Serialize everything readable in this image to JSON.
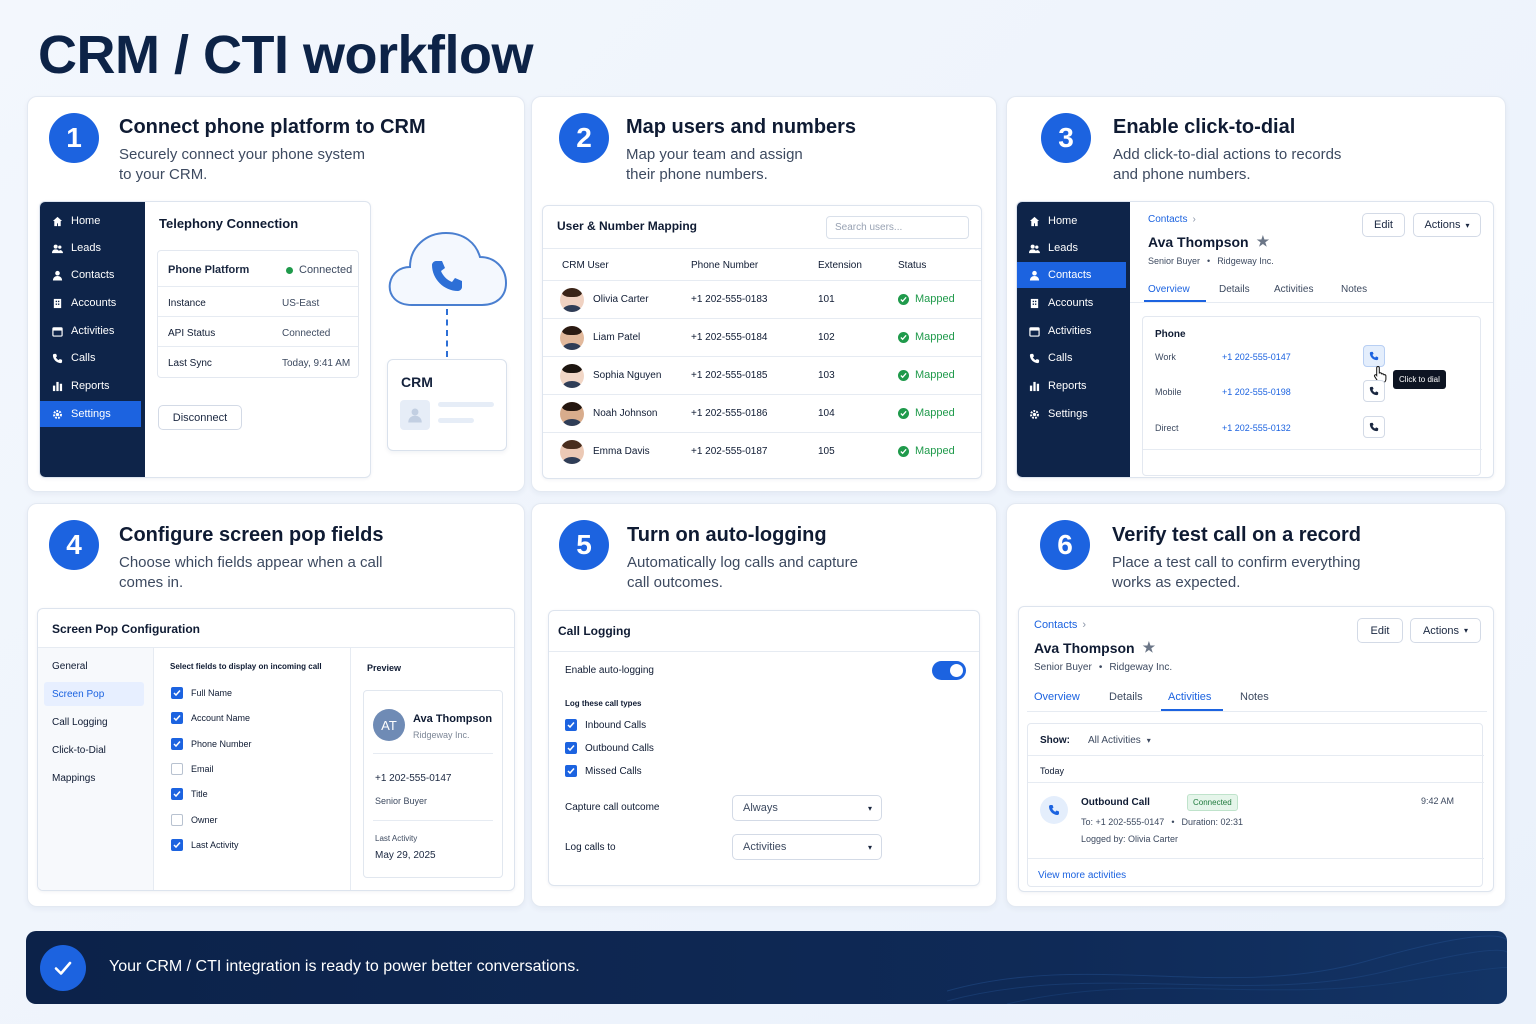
{
  "page_title": "CRM / CTI workflow",
  "colors": {
    "accent": "#1c63e0",
    "navy": "#0e2449",
    "success": "#1f9a4b"
  },
  "steps": [
    {
      "number": "1",
      "title": "Connect phone platform to CRM",
      "desc_line1": "Securely connect your phone system",
      "desc_line2": "to your CRM."
    },
    {
      "number": "2",
      "title": "Map users and numbers",
      "desc_line1": "Map your team and assign",
      "desc_line2": "their phone numbers."
    },
    {
      "number": "3",
      "title": "Enable click-to-dial",
      "desc_line1": "Add click-to-dial actions to records",
      "desc_line2": "and phone numbers."
    },
    {
      "number": "4",
      "title": "Configure screen pop fields",
      "desc_line1": "Choose which fields appear when a call",
      "desc_line2": "comes in."
    },
    {
      "number": "5",
      "title": "Turn on auto-logging",
      "desc_line1": "Automatically log calls and capture",
      "desc_line2": "call outcomes."
    },
    {
      "number": "6",
      "title": "Verify test call on a record",
      "desc_line1": "Place a test call to confirm everything",
      "desc_line2": "works as expected."
    }
  ],
  "nav": [
    "Home",
    "Leads",
    "Contacts",
    "Accounts",
    "Activities",
    "Calls",
    "Reports",
    "Settings"
  ],
  "telephony": {
    "title": "Telephony Connection",
    "platform_label": "Phone Platform",
    "platform_status": "Connected",
    "rows": [
      {
        "label": "Instance",
        "value": "US-East"
      },
      {
        "label": "API Status",
        "value": "Connected"
      },
      {
        "label": "Last Sync",
        "value": "Today, 9:41 AM"
      }
    ],
    "disconnect": "Disconnect",
    "crm_label": "CRM"
  },
  "mapping": {
    "title": "User & Number Mapping",
    "search_placeholder": "Search users...",
    "headers": [
      "CRM User",
      "Phone Number",
      "Extension",
      "Status"
    ],
    "rows": [
      {
        "user": "Olivia Carter",
        "phone": "+1 202-555-0183",
        "ext": "101",
        "status": "Mapped"
      },
      {
        "user": "Liam Patel",
        "phone": "+1 202-555-0184",
        "ext": "102",
        "status": "Mapped"
      },
      {
        "user": "Sophia Nguyen",
        "phone": "+1 202-555-0185",
        "ext": "103",
        "status": "Mapped"
      },
      {
        "user": "Noah Johnson",
        "phone": "+1 202-555-0186",
        "ext": "104",
        "status": "Mapped"
      },
      {
        "user": "Emma Davis",
        "phone": "+1 202-555-0187",
        "ext": "105",
        "status": "Mapped"
      }
    ]
  },
  "contact": {
    "breadcrumb": "Contacts",
    "name": "Ava Thompson",
    "role": "Senior Buyer",
    "company": "Ridgeway Inc.",
    "edit": "Edit",
    "actions": "Actions",
    "tabs": [
      "Overview",
      "Details",
      "Activities",
      "Notes"
    ],
    "phone_title": "Phone",
    "phones": [
      {
        "label": "Work",
        "number": "+1 202-555-0147"
      },
      {
        "label": "Mobile",
        "number": "+1 202-555-0198"
      },
      {
        "label": "Direct",
        "number": "+1 202-555-0132"
      }
    ],
    "tooltip": "Click to dial"
  },
  "screenpop": {
    "title": "Screen Pop Configuration",
    "menu": [
      "General",
      "Screen Pop",
      "Call Logging",
      "Click-to-Dial",
      "Mappings"
    ],
    "fields_title": "Select fields to display on incoming call",
    "fields": [
      {
        "label": "Full Name",
        "checked": true
      },
      {
        "label": "Account Name",
        "checked": true
      },
      {
        "label": "Phone Number",
        "checked": true
      },
      {
        "label": "Email",
        "checked": false
      },
      {
        "label": "Title",
        "checked": true
      },
      {
        "label": "Owner",
        "checked": false
      },
      {
        "label": "Last Activity",
        "checked": true
      }
    ],
    "preview_title": "Preview",
    "preview": {
      "initials": "AT",
      "name": "Ava Thompson",
      "company": "Ridgeway Inc.",
      "phone": "+1 202-555-0147",
      "role": "Senior Buyer",
      "last_activity_label": "Last Activity",
      "last_activity": "May 29, 2025"
    }
  },
  "logging": {
    "title": "Call Logging",
    "enable_label": "Enable auto-logging",
    "enabled": true,
    "types_title": "Log these call types",
    "types": [
      "Inbound Calls",
      "Outbound Calls",
      "Missed Calls"
    ],
    "outcome_label": "Capture call outcome",
    "outcome_value": "Always",
    "logto_label": "Log calls to",
    "logto_value": "Activities"
  },
  "verify": {
    "show_label": "Show:",
    "show_value": "All Activities",
    "today": "Today",
    "call_title": "Outbound Call",
    "call_badge": "Connected",
    "call_time": "9:42 AM",
    "call_to": "To: +1 202-555-0147",
    "call_duration": "Duration: 02:31",
    "logged_by": "Logged by: Olivia Carter",
    "view_more": "View more activities"
  },
  "banner_text": "Your CRM / CTI integration is ready to power better conversations."
}
